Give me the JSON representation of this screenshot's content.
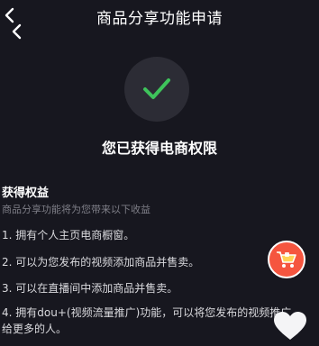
{
  "nav": {
    "title": "商品分享功能申请",
    "back_icon": "chevron-left-icon"
  },
  "status": {
    "icon": "checkmark-icon",
    "accent_color": "#3ec35b",
    "title": "您已获得电商权限"
  },
  "benefits": {
    "heading": "获得权益",
    "subtitle": "商品分享功能将为您带来以下收益",
    "items": [
      {
        "text": "1. 拥有个人主页电商橱窗。"
      },
      {
        "text": "2. 可以为您发布的视频添加商品并售卖。"
      },
      {
        "text": "3. 可以在直播间中添加商品并售卖。"
      },
      {
        "text": "4. 拥有dou+(视频流量推广)功能，可以将您发布的视频推广"
      },
      {
        "text": "给更多的人。"
      }
    ]
  },
  "floating": {
    "cart_icon": "shopping-cart-icon",
    "cart_color": "#f5553f",
    "like_icon": "heart-icon"
  }
}
